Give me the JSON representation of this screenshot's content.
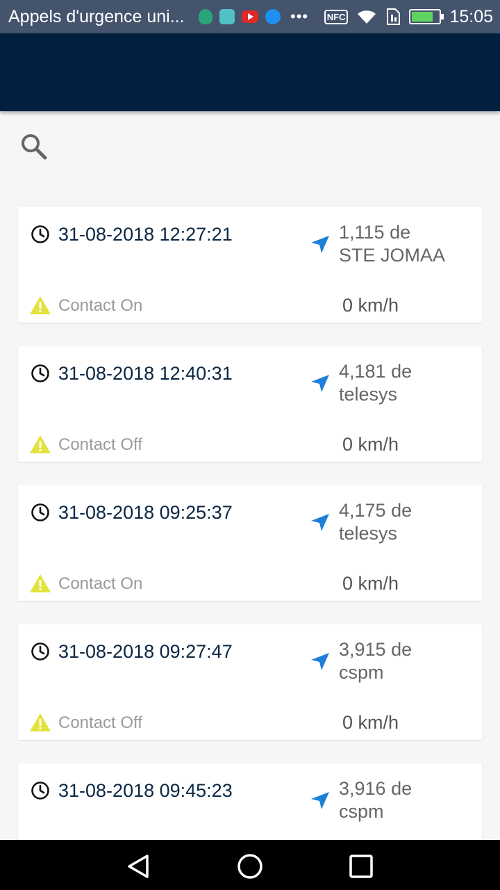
{
  "status_bar": {
    "title": "Appels d'urgence uni...",
    "nfc": "NFC",
    "time": "15:05"
  },
  "colors": {
    "app_bar": "#01203f",
    "status_bar": "#44546d",
    "accent_nav": "#1e7fd6",
    "warning": "#e2e23c"
  },
  "search": {
    "icon": "search-icon"
  },
  "events": [
    {
      "time": "31-08-2018 12:27:21",
      "location_line1": "1,115 de",
      "location_line2": "STE JOMAA",
      "status": "Contact On",
      "speed": "0 km/h"
    },
    {
      "time": "31-08-2018 12:40:31",
      "location_line1": "4,181 de",
      "location_line2": "telesys",
      "status": "Contact Off",
      "speed": "0 km/h"
    },
    {
      "time": "31-08-2018 09:25:37",
      "location_line1": "4,175 de",
      "location_line2": "telesys",
      "status": "Contact On",
      "speed": "0 km/h"
    },
    {
      "time": "31-08-2018 09:27:47",
      "location_line1": "3,915 de",
      "location_line2": "cspm",
      "status": "Contact Off",
      "speed": "0 km/h"
    },
    {
      "time": "31-08-2018 09:45:23",
      "location_line1": "3,916 de",
      "location_line2": "cspm",
      "status": "",
      "speed": ""
    }
  ]
}
